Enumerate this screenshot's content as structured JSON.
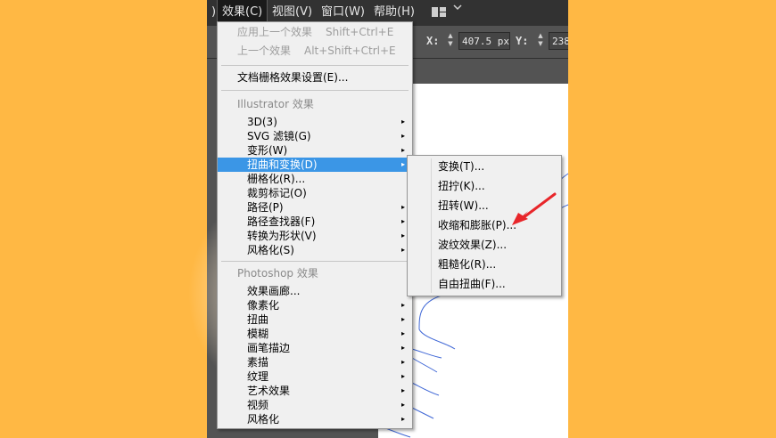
{
  "menubar": {
    "items": [
      {
        "label": ")",
        "active": false
      },
      {
        "label": "效果(C)",
        "active": true
      },
      {
        "label": "视图(V)",
        "active": false
      },
      {
        "label": "窗口(W)",
        "active": false
      },
      {
        "label": "帮助(H)",
        "active": false
      }
    ],
    "workspace_icon": "grid-layout-icon",
    "chevron_icon": "chevron-down-icon"
  },
  "controlbar": {
    "x_label": "X:",
    "x_value": "407.5 px",
    "y_label": "Y:",
    "y_value": "238"
  },
  "effect_menu": {
    "apply_last": {
      "label": "应用上一个效果",
      "shortcut": "Shift+Ctrl+E"
    },
    "last_effect": {
      "label": "上一个效果",
      "shortcut": "Alt+Shift+Ctrl+E"
    },
    "document_raster_settings": "文档栅格效果设置(E)...",
    "illustrator_header": "Illustrator 效果",
    "illustrator_items": [
      {
        "label": "3D(3)",
        "submenu": true
      },
      {
        "label": "SVG 滤镜(G)",
        "submenu": true
      },
      {
        "label": "变形(W)",
        "submenu": true
      },
      {
        "label": "扭曲和变换(D)",
        "submenu": true,
        "highlighted": true
      },
      {
        "label": "栅格化(R)...",
        "submenu": false
      },
      {
        "label": "裁剪标记(O)",
        "submenu": false
      },
      {
        "label": "路径(P)",
        "submenu": true
      },
      {
        "label": "路径查找器(F)",
        "submenu": true
      },
      {
        "label": "转换为形状(V)",
        "submenu": true
      },
      {
        "label": "风格化(S)",
        "submenu": true
      }
    ],
    "photoshop_header": "Photoshop 效果",
    "photoshop_items": [
      {
        "label": "效果画廊...",
        "submenu": false
      },
      {
        "label": "像素化",
        "submenu": true
      },
      {
        "label": "扭曲",
        "submenu": true
      },
      {
        "label": "模糊",
        "submenu": true
      },
      {
        "label": "画笔描边",
        "submenu": true
      },
      {
        "label": "素描",
        "submenu": true
      },
      {
        "label": "纹理",
        "submenu": true
      },
      {
        "label": "艺术效果",
        "submenu": true
      },
      {
        "label": "视频",
        "submenu": true
      },
      {
        "label": "风格化",
        "submenu": true
      }
    ],
    "submenu_arrow": "▸"
  },
  "distort_submenu": {
    "items": [
      "变换(T)...",
      "扭拧(K)...",
      "扭转(W)...",
      "收缩和膨胀(P)...",
      "波纹效果(Z)...",
      "粗糙化(R)...",
      "自由扭曲(F)..."
    ]
  },
  "colors": {
    "page_bg": "#ffb844",
    "menubar_bg": "#323232",
    "menu_bg": "#f0f0f0",
    "highlight": "#3b96e6",
    "annotation_arrow": "#e8262a",
    "shape_stroke": "#3f67d6"
  }
}
